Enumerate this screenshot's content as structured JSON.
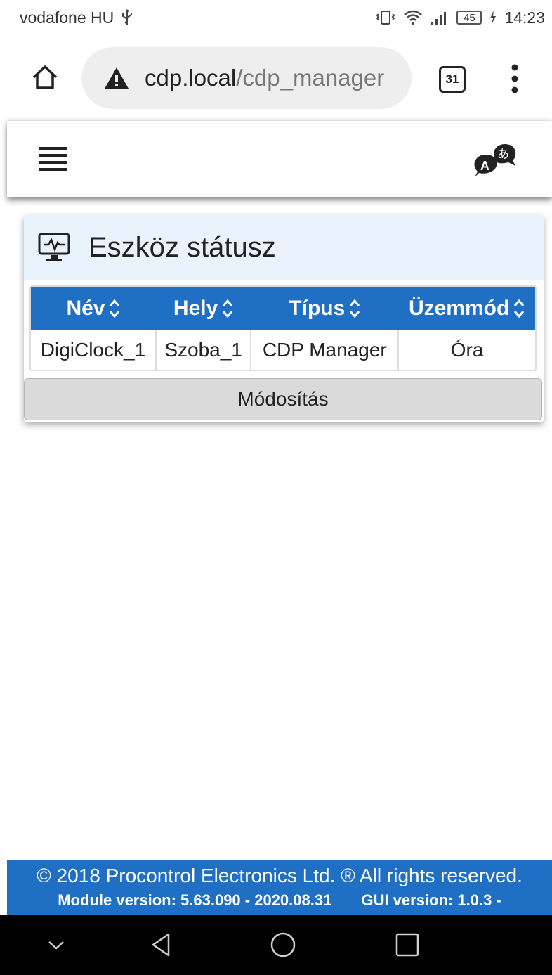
{
  "status_bar": {
    "carrier": "vodafone HU",
    "battery": "45",
    "time": "14:23"
  },
  "browser": {
    "url_host": "cdp.local",
    "url_path": "/cdp_manager",
    "tab_count": "31"
  },
  "panel": {
    "title": "Eszköz státusz",
    "columns": [
      "Név",
      "Hely",
      "Típus",
      "Üzemmód"
    ],
    "rows": [
      [
        "DigiClock_1",
        "Szoba_1",
        "CDP Manager",
        "Óra"
      ]
    ],
    "modify_label": "Módosítás"
  },
  "footer": {
    "copyright": "© 2018 Procontrol Electronics Ltd. ® All rights reserved.",
    "module_version": "Module version: 5.63.090 - 2020.08.31",
    "gui_version": "GUI version: 1.0.3 -"
  },
  "colors": {
    "accent": "#1f6fc5",
    "panel_header_bg": "#eaf3fc",
    "button_bg": "#dadada"
  }
}
